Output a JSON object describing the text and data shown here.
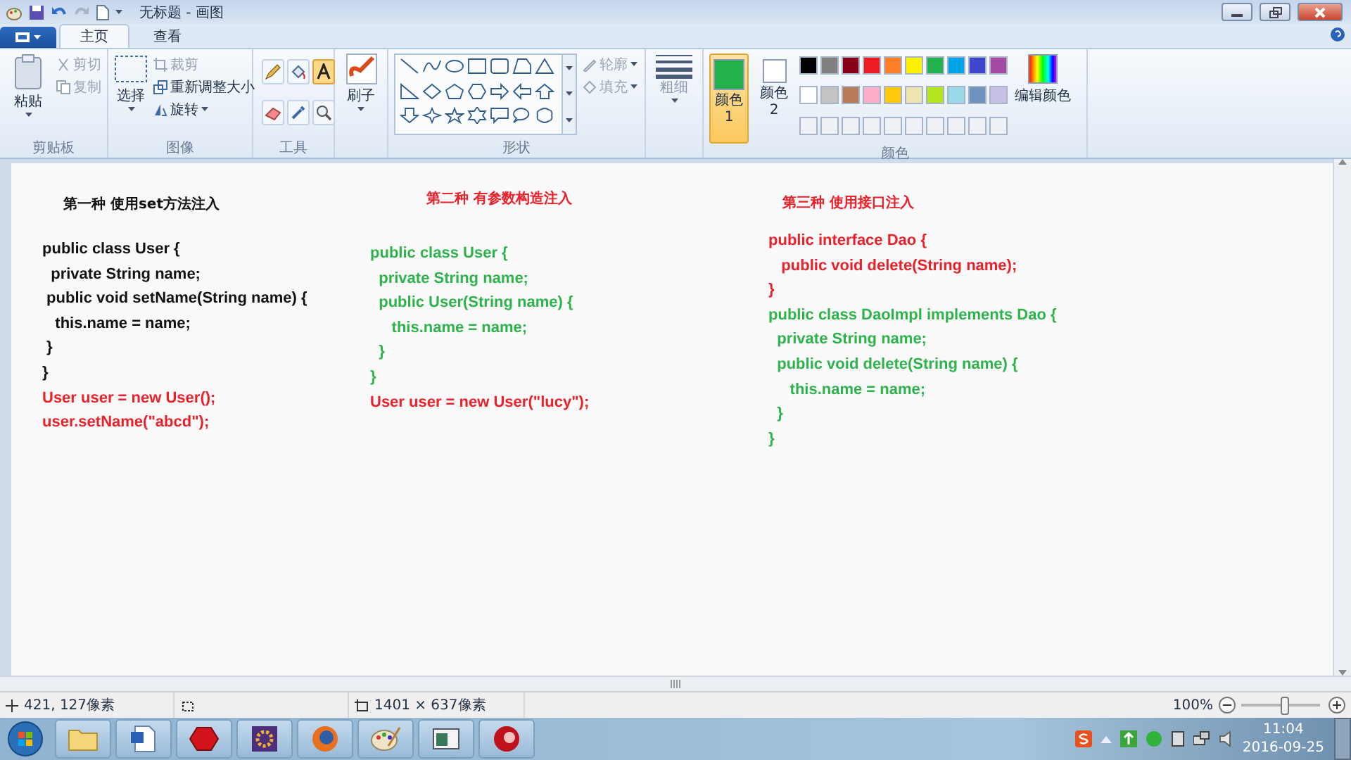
{
  "window": {
    "title": "无标题 - 画图"
  },
  "tabs": [
    {
      "label": "主页",
      "selected": true
    },
    {
      "label": "查看",
      "selected": false
    }
  ],
  "clipboard": {
    "label": "剪贴板",
    "paste": "粘贴",
    "cut": {
      "label": "剪切",
      "disabled": true
    },
    "copy": {
      "label": "复制",
      "disabled": true
    }
  },
  "image": {
    "label": "图像",
    "select": "选择",
    "crop": {
      "label": "裁剪",
      "disabled": true
    },
    "resize": "重新调整大小",
    "rotate": "旋转"
  },
  "tools": {
    "label": "工具",
    "items": [
      {
        "kind": "pencil",
        "selected": false
      },
      {
        "kind": "fill",
        "selected": false
      },
      {
        "kind": "text",
        "selected": true
      },
      {
        "kind": "eraser",
        "selected": false
      },
      {
        "kind": "picker",
        "selected": false
      },
      {
        "kind": "magnifier",
        "selected": false
      }
    ]
  },
  "brush": {
    "label": "刷子"
  },
  "shapes": {
    "label": "形状",
    "outline": {
      "label": "轮廓",
      "disabled": true
    },
    "fill": {
      "label": "填充",
      "disabled": true
    }
  },
  "size": {
    "label": "粗细"
  },
  "colors": {
    "label": "颜色",
    "color1": {
      "label": "颜色 1",
      "color": "#22b14c",
      "selected": true
    },
    "color2": {
      "label": "颜色 2",
      "color": "#ffffff",
      "selected": false
    },
    "edit": "编辑颜色",
    "palette": [
      {
        "color": "#000000"
      },
      {
        "color": "#7f7f7f"
      },
      {
        "color": "#880015"
      },
      {
        "color": "#ed1c24"
      },
      {
        "color": "#ff7f27"
      },
      {
        "color": "#fff200"
      },
      {
        "color": "#22b14c"
      },
      {
        "color": "#00a2e8"
      },
      {
        "color": "#3f48cc"
      },
      {
        "color": "#a349a4"
      },
      {
        "color": "#ffffff"
      },
      {
        "color": "#c3c3c3"
      },
      {
        "color": "#b97a57"
      },
      {
        "color": "#ffaec9"
      },
      {
        "color": "#ffc90e"
      },
      {
        "color": "#efe4b0"
      },
      {
        "color": "#b5e61d"
      },
      {
        "color": "#99d9ea"
      },
      {
        "color": "#7092be"
      },
      {
        "color": "#c8bfe7"
      }
    ]
  },
  "canvas": {
    "blocks": [
      {
        "heading": {
          "text": "第一种 使用set方法注入",
          "color": "#111111"
        },
        "lines": [
          {
            "text": "public class User {",
            "color": "#111111"
          },
          {
            "text": "  private String name;",
            "color": "#111111"
          },
          {
            "text": " public void setName(String name) {",
            "color": "#111111"
          },
          {
            "text": "   this.name = name;",
            "color": "#111111"
          },
          {
            "text": " }",
            "color": "#111111"
          },
          {
            "text": "}",
            "color": "#111111"
          },
          {
            "text": "User user = new User();",
            "color": "#e8212b"
          },
          {
            "text": "user.setName(\"abcd\");",
            "color": "#e8212b"
          }
        ]
      },
      {
        "heading": {
          "text": "第二种 有参数构造注入",
          "color": "#e8212b"
        },
        "lines": [
          {
            "text": "public class User {",
            "color": "#2eb34c"
          },
          {
            "text": "  private String name;",
            "color": "#2eb34c"
          },
          {
            "text": "  public User(String name) {",
            "color": "#2eb34c"
          },
          {
            "text": "     this.name = name;",
            "color": "#2eb34c"
          },
          {
            "text": "  }",
            "color": "#2eb34c"
          },
          {
            "text": "}",
            "color": "#2eb34c"
          },
          {
            "text": "User user = new User(\"lucy\");",
            "color": "#e8212b"
          }
        ]
      },
      {
        "heading": {
          "text": "第三种 使用接口注入",
          "color": "#e8212b"
        },
        "lines": [
          {
            "text": "public interface Dao {",
            "color": "#e8212b"
          },
          {
            "text": "   public void delete(String name);",
            "color": "#e8212b"
          },
          {
            "text": "}",
            "color": "#e8212b"
          },
          {
            "text": "public class DaoImpl implements Dao {",
            "color": "#2eb34c"
          },
          {
            "text": "  private String name;",
            "color": "#2eb34c"
          },
          {
            "text": "  public void delete(String name) {",
            "color": "#2eb34c"
          },
          {
            "text": "     this.name = name;",
            "color": "#2eb34c"
          },
          {
            "text": "  }",
            "color": "#2eb34c"
          },
          {
            "text": "}",
            "color": "#2eb34c"
          }
        ]
      }
    ]
  },
  "status_bar": {
    "cursor": "421, 127像素",
    "size": "1401 × 637像素",
    "zoom": "100%",
    "zoom_slider": {
      "level": 0.55
    }
  },
  "taskbar": {
    "apps": [
      {
        "kind": "folder"
      },
      {
        "kind": "document"
      },
      {
        "kind": "hexagon"
      },
      {
        "kind": "gear"
      },
      {
        "kind": "globe"
      },
      {
        "kind": "palette"
      },
      {
        "kind": "window"
      },
      {
        "kind": "sphere"
      }
    ],
    "time": "11:04",
    "date": "2016-09-25"
  }
}
